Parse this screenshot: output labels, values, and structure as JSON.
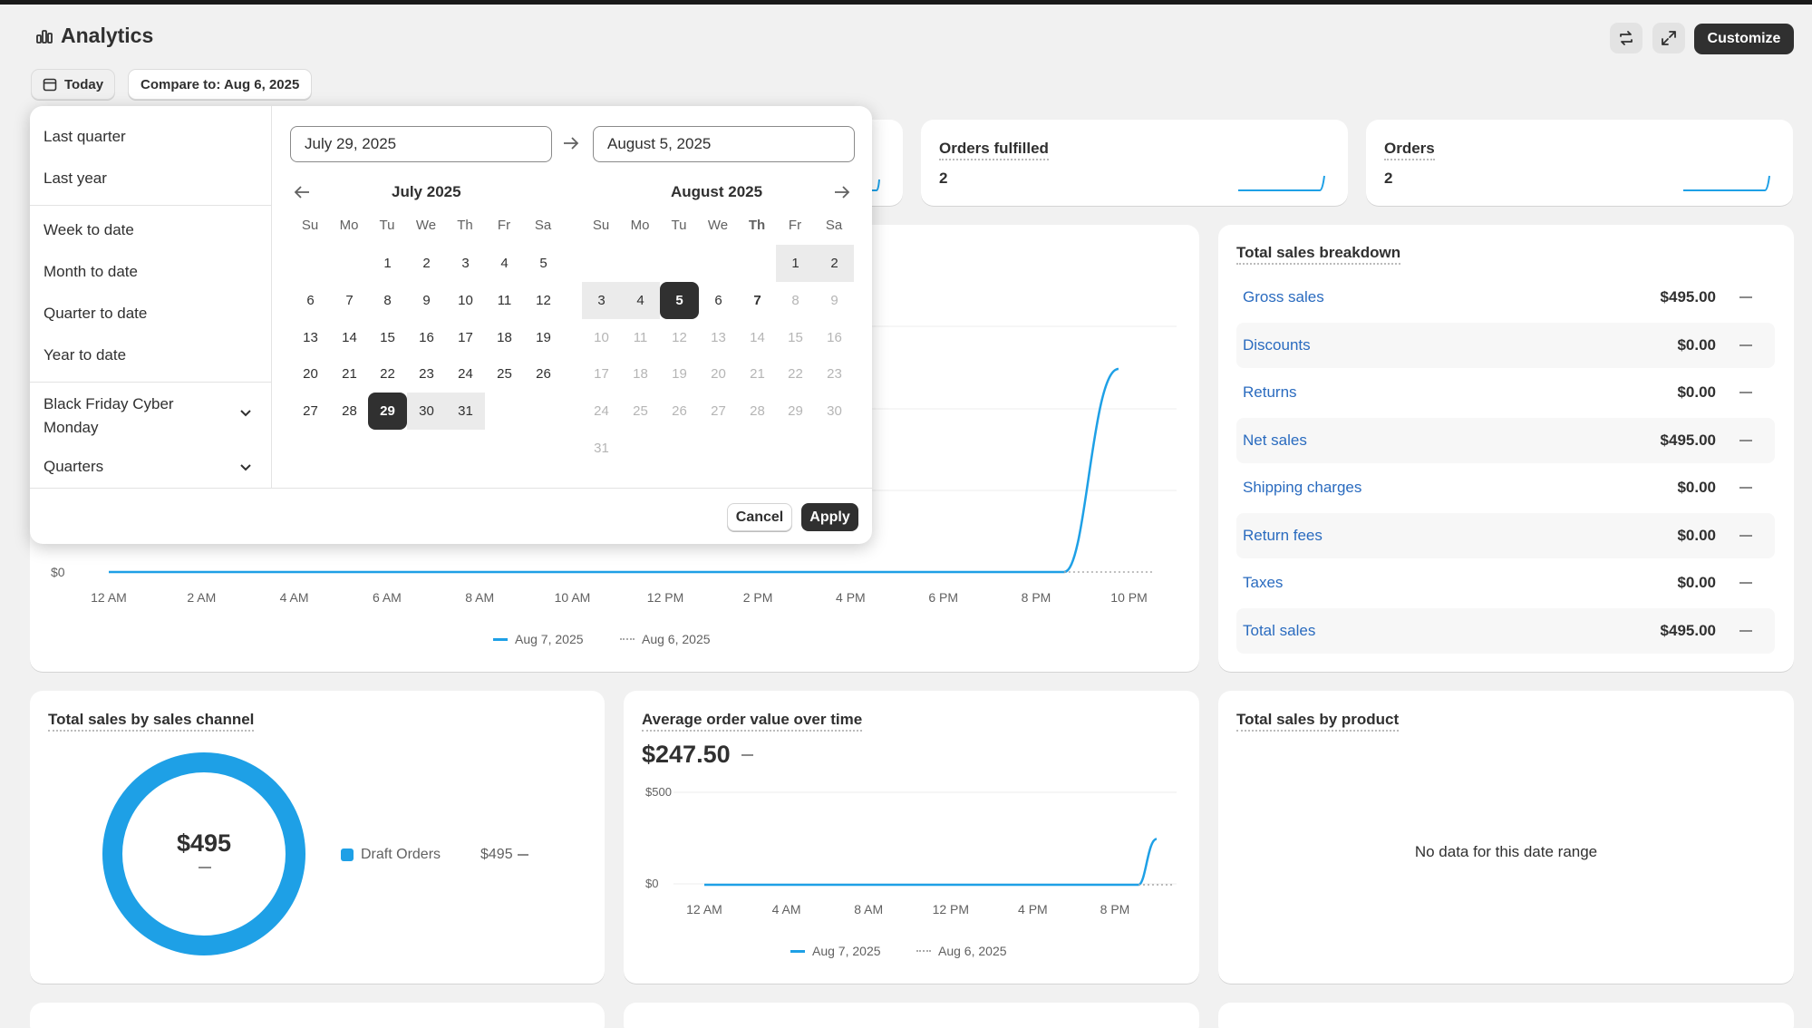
{
  "header": {
    "title": "Analytics",
    "customize_label": "Customize"
  },
  "filters": {
    "date_label": "Today",
    "compare_label": "Compare to: Aug 6, 2025"
  },
  "metrics": [
    {
      "title": "Orders fulfilled",
      "value": "2"
    },
    {
      "title": "Orders",
      "value": "2"
    }
  ],
  "main_chart": {
    "y_label": "$0",
    "x_ticks": [
      "12 AM",
      "2 AM",
      "4 AM",
      "6 AM",
      "8 AM",
      "10 AM",
      "12 PM",
      "2 PM",
      "4 PM",
      "6 PM",
      "8 PM",
      "10 PM"
    ],
    "legend": [
      "Aug 7, 2025",
      "Aug 6, 2025"
    ]
  },
  "breakdown": {
    "title": "Total sales breakdown",
    "rows": [
      {
        "label": "Gross sales",
        "value": "$495.00"
      },
      {
        "label": "Discounts",
        "value": "$0.00"
      },
      {
        "label": "Returns",
        "value": "$0.00"
      },
      {
        "label": "Net sales",
        "value": "$495.00"
      },
      {
        "label": "Shipping charges",
        "value": "$0.00"
      },
      {
        "label": "Return fees",
        "value": "$0.00"
      },
      {
        "label": "Taxes",
        "value": "$0.00"
      },
      {
        "label": "Total sales",
        "value": "$495.00"
      }
    ]
  },
  "channel": {
    "title": "Total sales by sales channel",
    "total": "$495",
    "legend_label": "Draft Orders",
    "legend_value": "$495"
  },
  "aov": {
    "title": "Average order value over time",
    "value": "$247.50",
    "y_ticks": [
      "$500",
      "$0"
    ],
    "x_ticks": [
      "12 AM",
      "4 AM",
      "8 AM",
      "12 PM",
      "4 PM",
      "8 PM"
    ],
    "legend": [
      "Aug 7, 2025",
      "Aug 6, 2025"
    ]
  },
  "product": {
    "title": "Total sales by product",
    "empty": "No data for this date range"
  },
  "picker": {
    "presets": [
      "Last quarter",
      "Last year",
      "Week to date",
      "Month to date",
      "Quarter to date",
      "Year to date"
    ],
    "group1": "Black Friday Cyber Monday",
    "group2": "Quarters",
    "start": "July 29, 2025",
    "end": "August 5, 2025",
    "month1": "July 2025",
    "month2": "August 2025",
    "dow": [
      "Su",
      "Mo",
      "Tu",
      "We",
      "Th",
      "Fr",
      "Sa"
    ],
    "cancel": "Cancel",
    "apply": "Apply"
  },
  "colors": {
    "accent": "#1ea0e6",
    "link": "#2a6bbf",
    "dark": "#303030"
  },
  "chart_data": [
    {
      "type": "line",
      "x": [
        "12 AM",
        "2 AM",
        "4 AM",
        "6 AM",
        "8 AM",
        "10 AM",
        "12 PM",
        "2 PM",
        "4 PM",
        "6 PM",
        "8 PM",
        "10 PM"
      ],
      "series": [
        {
          "name": "Aug 7, 2025",
          "values": [
            0,
            0,
            0,
            0,
            0,
            0,
            0,
            0,
            0,
            0,
            0,
            495
          ]
        },
        {
          "name": "Aug 6, 2025",
          "values": [
            0,
            0,
            0,
            0,
            0,
            0,
            0,
            0,
            0,
            0,
            0,
            0
          ]
        }
      ]
    },
    {
      "type": "line",
      "title": "Average order value over time",
      "x": [
        "12 AM",
        "4 AM",
        "8 AM",
        "12 PM",
        "4 PM",
        "8 PM"
      ],
      "ylim": [
        0,
        500
      ],
      "series": [
        {
          "name": "Aug 7, 2025",
          "values": [
            0,
            0,
            0,
            0,
            0,
            247.5
          ]
        },
        {
          "name": "Aug 6, 2025",
          "values": [
            0,
            0,
            0,
            0,
            0,
            0
          ]
        }
      ]
    },
    {
      "type": "pie",
      "title": "Total sales by sales channel",
      "categories": [
        "Draft Orders"
      ],
      "values": [
        495
      ]
    }
  ]
}
